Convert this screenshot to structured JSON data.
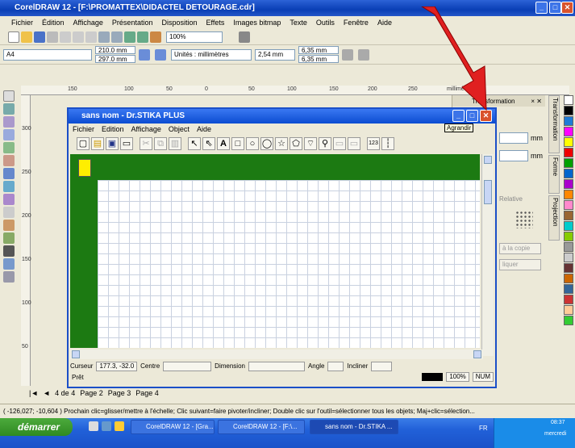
{
  "corel": {
    "title": "CorelDRAW 12 - [F:\\PROMATTEX\\DIDACTEL DETOURAGE.cdr]",
    "menu": [
      "Fichier",
      "Édition",
      "Affichage",
      "Présentation",
      "Disposition",
      "Effets",
      "Images bitmap",
      "Texte",
      "Outils",
      "Fenêtre",
      "Aide"
    ],
    "page_size": "A4",
    "width": "210.0 mm",
    "height": "297.0 mm",
    "units": "Unités : millimètres",
    "nudge": "2,54 mm",
    "dup_x": "6,35 mm",
    "dup_y": "6,35 mm",
    "zoom": "100%",
    "ruler_units": "millimètres",
    "ruler_h": [
      "150",
      "100",
      "50",
      "0",
      "50",
      "100",
      "150",
      "200",
      "250"
    ],
    "ruler_v": [
      "300",
      "250",
      "200",
      "150",
      "100",
      "50"
    ],
    "docker_title": "Transformation",
    "docker_tabs": [
      "Transformation",
      "Forme",
      "Projection"
    ],
    "docker_unit": "mm",
    "docker_relative": "Relative",
    "docker_apply_copy": "à la copie",
    "docker_apply": "liquer",
    "pages": [
      "4 de 4",
      "Page 2",
      "Page 3",
      "Page 4"
    ],
    "status": "( -126,027; -10,604 )   Prochain clic=glisser/mettre à l'échelle; Clic suivant=faire pivoter/incliner; Double clic sur l'outil=sélectionner tous les objets; Maj+clic=sélection..."
  },
  "stika": {
    "title": "sans nom - Dr.STIKA PLUS",
    "menu": [
      "Fichier",
      "Edition",
      "Affichage",
      "Object",
      "Aide"
    ],
    "tooltip": "Agrandir",
    "status": {
      "cursor_label": "Curseur",
      "cursor_value": "177.3, -32.0",
      "centre": "Centre",
      "dimension": "Dimension",
      "angle": "Angle",
      "incliner": "Incliner"
    },
    "ready": "Prêt",
    "zoom": "100%",
    "num": "NUM"
  },
  "taskbar": {
    "start": "démarrer",
    "tasks": [
      "CorelDRAW 12 - [Gra...",
      "CorelDRAW 12 - [F:\\...",
      "sans nom - Dr.STIKA ..."
    ],
    "lang": "FR",
    "time": "08:37",
    "day": "mercredi"
  },
  "colors": {
    "canvas_green": "#1c7a12",
    "xp_blue": "#0b4cd1",
    "arrow_red": "#e02020"
  }
}
